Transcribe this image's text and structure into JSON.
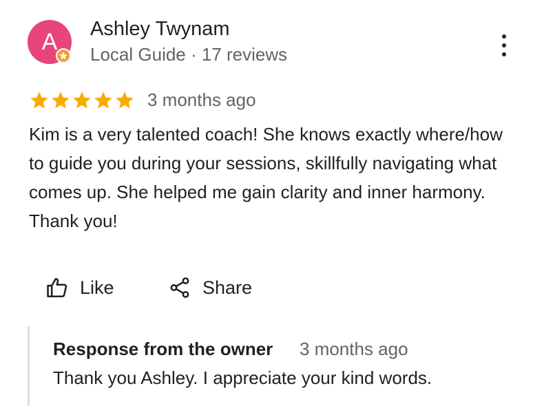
{
  "reviewer": {
    "initial": "A",
    "name": "Ashley Twynam",
    "meta": "Local Guide · 17 reviews",
    "avatar_color": "#e8457b",
    "badge_color": "#f29d3b",
    "badge_icon": "local-guide-star-icon"
  },
  "review": {
    "rating": 5,
    "max_rating": 5,
    "star_color": "#f9ab00",
    "date": "3 months ago",
    "text": "Kim is a very talented coach! She knows exactly where/how to guide you during your sessions, skillfully navigating what comes up. She helped me gain clarity and inner harmony. Thank you!"
  },
  "actions": {
    "like_label": "Like",
    "like_icon": "thumbs-up-icon",
    "share_label": "Share",
    "share_icon": "share-icon",
    "more_icon": "more-vert-icon"
  },
  "owner_response": {
    "title": "Response from the owner",
    "date": "3 months ago",
    "text": "Thank you Ashley. I appreciate your kind words."
  }
}
